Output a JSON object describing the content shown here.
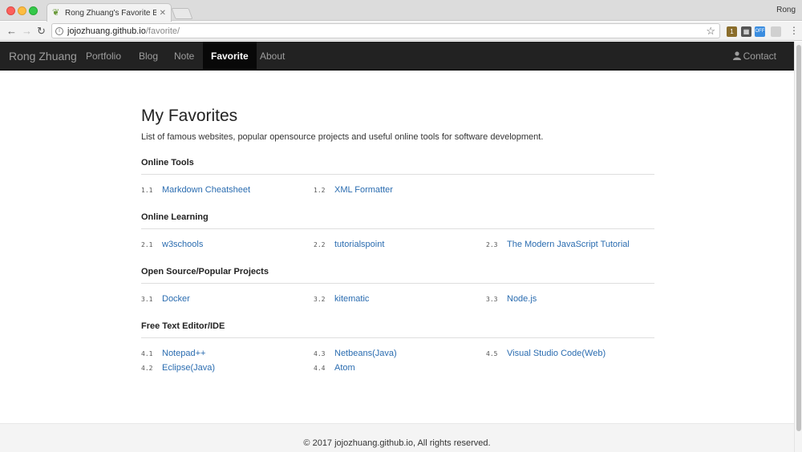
{
  "browser": {
    "tab_title": "Rong Zhuang's Favorite Bookm",
    "profile_name": "Rong",
    "url_host": "jojozhuang.github.io",
    "url_path": "/favorite/",
    "ext_badge": "1",
    "ext_off": "OFF"
  },
  "navbar": {
    "brand": "Rong Zhuang",
    "items": [
      {
        "label": "Portfolio"
      },
      {
        "label": "Blog"
      },
      {
        "label": "Note"
      },
      {
        "label": "Favorite",
        "active": true
      },
      {
        "label": "About"
      }
    ],
    "contact": "Contact"
  },
  "page": {
    "title": "My Favorites",
    "description": "List of famous websites, popular opensource projects and useful online tools for software development."
  },
  "sections": [
    {
      "title": "Online Tools",
      "items": [
        {
          "num": "1.1",
          "label": "Markdown Cheatsheet"
        },
        {
          "num": "1.2",
          "label": "XML Formatter"
        }
      ]
    },
    {
      "title": "Online Learning",
      "items": [
        {
          "num": "2.1",
          "label": "w3schools"
        },
        {
          "num": "2.2",
          "label": "tutorialspoint"
        },
        {
          "num": "2.3",
          "label": "The Modern JavaScript Tutorial"
        }
      ]
    },
    {
      "title": "Open Source/Popular Projects",
      "items": [
        {
          "num": "3.1",
          "label": "Docker"
        },
        {
          "num": "3.2",
          "label": "kitematic"
        },
        {
          "num": "3.3",
          "label": "Node.js"
        }
      ]
    },
    {
      "title": "Free Text Editor/IDE",
      "items": [
        {
          "num": "4.1",
          "label": "Notepad++"
        },
        {
          "num": "4.2",
          "label": "Eclipse(Java)"
        },
        {
          "num": "4.3",
          "label": "Netbeans(Java)"
        },
        {
          "num": "4.4",
          "label": "Atom"
        },
        {
          "num": "4.5",
          "label": "Visual Studio Code(Web)"
        }
      ]
    }
  ],
  "footer": {
    "text": "© 2017 jojozhuang.github.io, All rights reserved."
  },
  "colors": {
    "navbar_bg": "#222222",
    "link": "#2a6cb0",
    "footer_bg": "#f4f4f4"
  }
}
